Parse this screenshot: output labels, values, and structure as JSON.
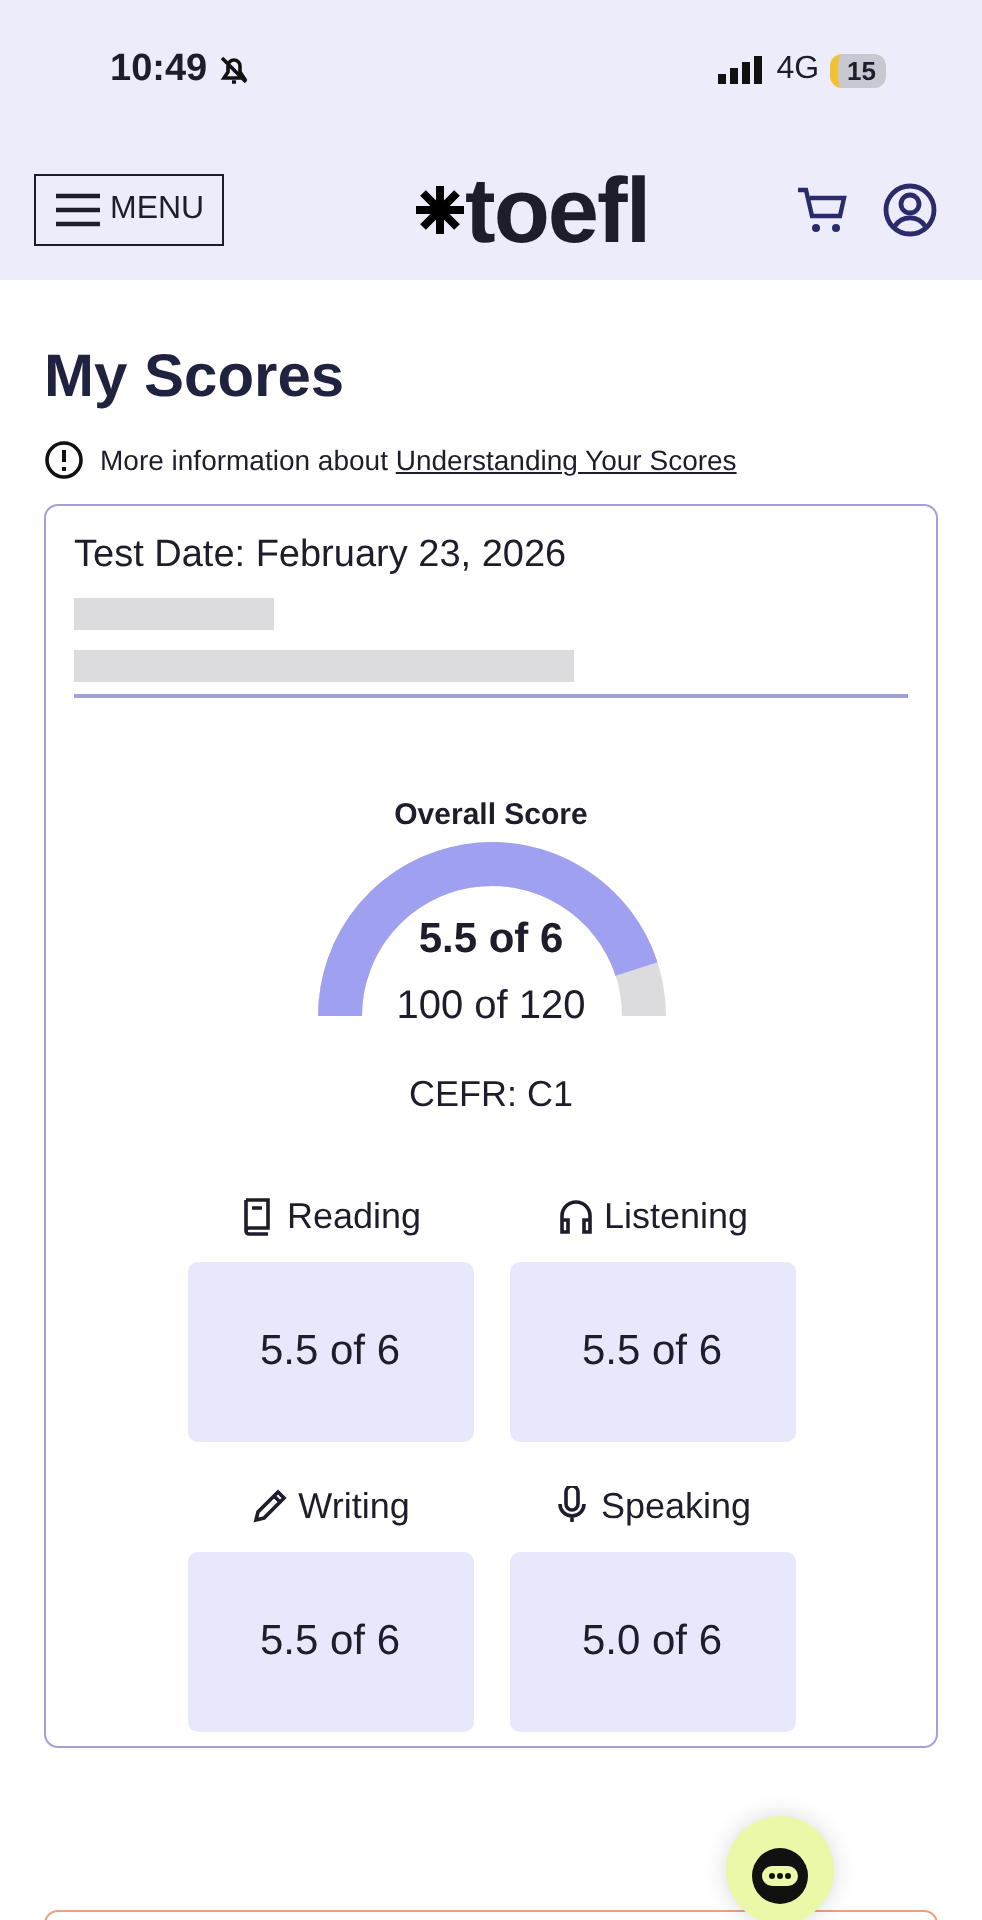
{
  "status_bar": {
    "time": "10:49",
    "network": "4G",
    "battery": "15"
  },
  "header": {
    "menu_label": "MENU",
    "logo": "toefl"
  },
  "page_title": "My Scores",
  "info": {
    "text": "More information about ",
    "link": "Understanding Your Scores"
  },
  "score_card": {
    "test_date": "Test Date: February 23, 2026",
    "overall": {
      "title": "Overall Score",
      "score": "5.5 of 6",
      "scaled": "100 of 120",
      "cefr": "CEFR: C1"
    },
    "sections": [
      {
        "kind": "reading",
        "label": "Reading",
        "score": "5.5 of 6"
      },
      {
        "kind": "listening",
        "label": "Listening",
        "score": "5.5 of 6"
      },
      {
        "kind": "writing",
        "label": "Writing",
        "score": "5.5 of 6"
      },
      {
        "kind": "speaking",
        "label": "Speaking",
        "score": "5.0 of 6"
      }
    ]
  }
}
